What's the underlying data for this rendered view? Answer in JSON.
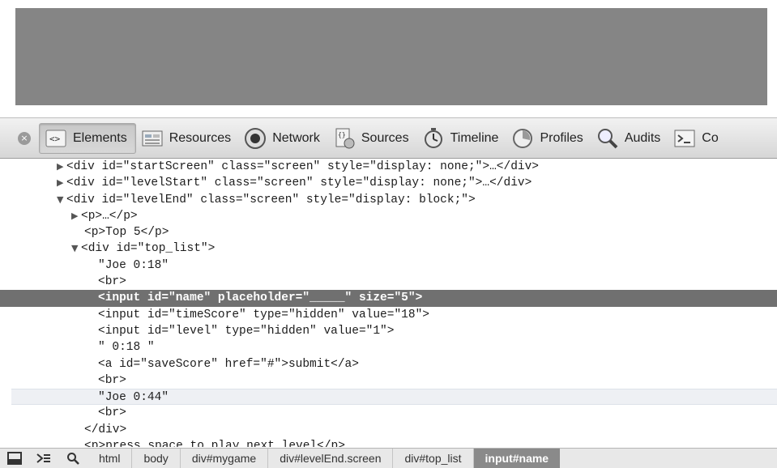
{
  "toolbar": {
    "close_glyph": "×",
    "tabs": [
      {
        "label": "Elements",
        "icon": "elements-icon"
      },
      {
        "label": "Resources",
        "icon": "resources-icon"
      },
      {
        "label": "Network",
        "icon": "network-icon"
      },
      {
        "label": "Sources",
        "icon": "sources-icon"
      },
      {
        "label": "Timeline",
        "icon": "timeline-icon"
      },
      {
        "label": "Profiles",
        "icon": "profiles-icon"
      },
      {
        "label": "Audits",
        "icon": "audits-icon"
      },
      {
        "label": "Co",
        "icon": "console-icon"
      }
    ]
  },
  "dom_tree": [
    {
      "text": "<div id=\"startScreen\" class=\"screen\" style=\"display: none;\">…</div>",
      "marker": "▶"
    },
    {
      "text": "<div id=\"levelStart\" class=\"screen\" style=\"display: none;\">…</div>",
      "marker": "▶"
    },
    {
      "text": "<div id=\"levelEnd\" class=\"screen\" style=\"display: block;\">",
      "marker": "▼"
    },
    {
      "text": "<p>…</p>",
      "marker": "▶"
    },
    {
      "text": "<p>Top 5</p>",
      "marker": ""
    },
    {
      "text": "<div id=\"top_list\">",
      "marker": "▼"
    },
    {
      "text": "\"Joe 0:18\"",
      "marker": ""
    },
    {
      "text": "<br>",
      "marker": ""
    },
    {
      "text": "<input id=\"name\" placeholder=\"_____\" size=\"5\">",
      "marker": ""
    },
    {
      "text": "<input id=\"timeScore\" type=\"hidden\" value=\"18\">",
      "marker": ""
    },
    {
      "text": "<input id=\"level\" type=\"hidden\" value=\"1\">",
      "marker": ""
    },
    {
      "text": "\" 0:18 \"",
      "marker": ""
    },
    {
      "text": "<a id=\"saveScore\" href=\"#\">submit</a>",
      "marker": ""
    },
    {
      "text": "<br>",
      "marker": ""
    },
    {
      "text": "\"Joe 0:44\"",
      "marker": ""
    },
    {
      "text": "<br>",
      "marker": ""
    },
    {
      "text": "</div>",
      "marker": ""
    },
    {
      "text": "<p>press space to play next level</p>",
      "marker": ""
    }
  ],
  "statusbar": {
    "icons": [
      "dock-icon",
      "console-toggle-icon",
      "search-icon"
    ],
    "breadcrumbs": [
      "html",
      "body",
      "div#mygame",
      "div#levelEnd.screen",
      "div#top_list",
      "input#name"
    ],
    "active_crumb": "input#name"
  }
}
